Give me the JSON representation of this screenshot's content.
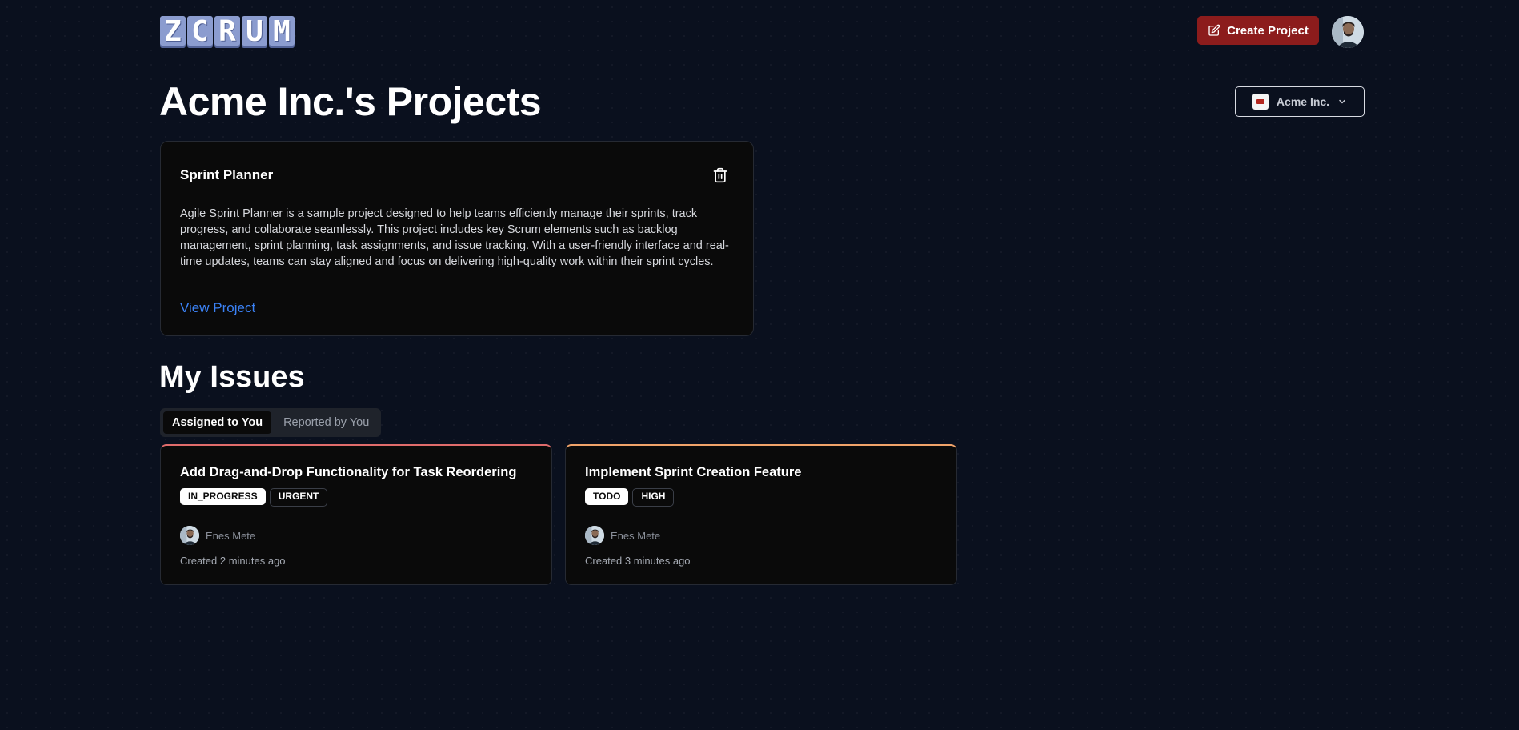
{
  "header": {
    "logo_letters": [
      "Z",
      "C",
      "R",
      "U",
      "M"
    ],
    "create_label": "Create Project"
  },
  "org": {
    "title": "Acme Inc.'s Projects",
    "selected": "Acme Inc."
  },
  "project": {
    "name": "Sprint Planner",
    "description": "Agile Sprint Planner is a sample project designed to help teams efficiently manage their sprints, track progress, and collaborate seamlessly. This project includes key Scrum elements such as backlog management, sprint planning, task assignments, and issue tracking. With a user-friendly interface and real-time updates, teams can stay aligned and focus on delivering high-quality work within their sprint cycles.",
    "link": "View Project"
  },
  "issues": {
    "title": "My Issues",
    "tabs": [
      "Assigned to You",
      "Reported by You"
    ],
    "active_tab": 0,
    "items": [
      {
        "title": "Add Drag-and-Drop Functionality for Task Reordering",
        "status": "IN_PROGRESS",
        "priority": "URGENT",
        "assignee": "Enes Mete",
        "created": "Created 2 minutes ago",
        "accent": "#e06c6c"
      },
      {
        "title": "Implement Sprint Creation Feature",
        "status": "TODO",
        "priority": "HIGH",
        "assignee": "Enes Mete",
        "created": "Created 3 minutes ago",
        "accent": "#f0a36a"
      }
    ]
  },
  "colors": {
    "background": "#0a101e",
    "create_button": "#8c1c1c",
    "link": "#3b82f6",
    "logo": "#8b9ccf"
  },
  "icons": [
    "pencil-square-icon",
    "trash-icon",
    "chevron-down-icon",
    "user-avatar-icon"
  ]
}
